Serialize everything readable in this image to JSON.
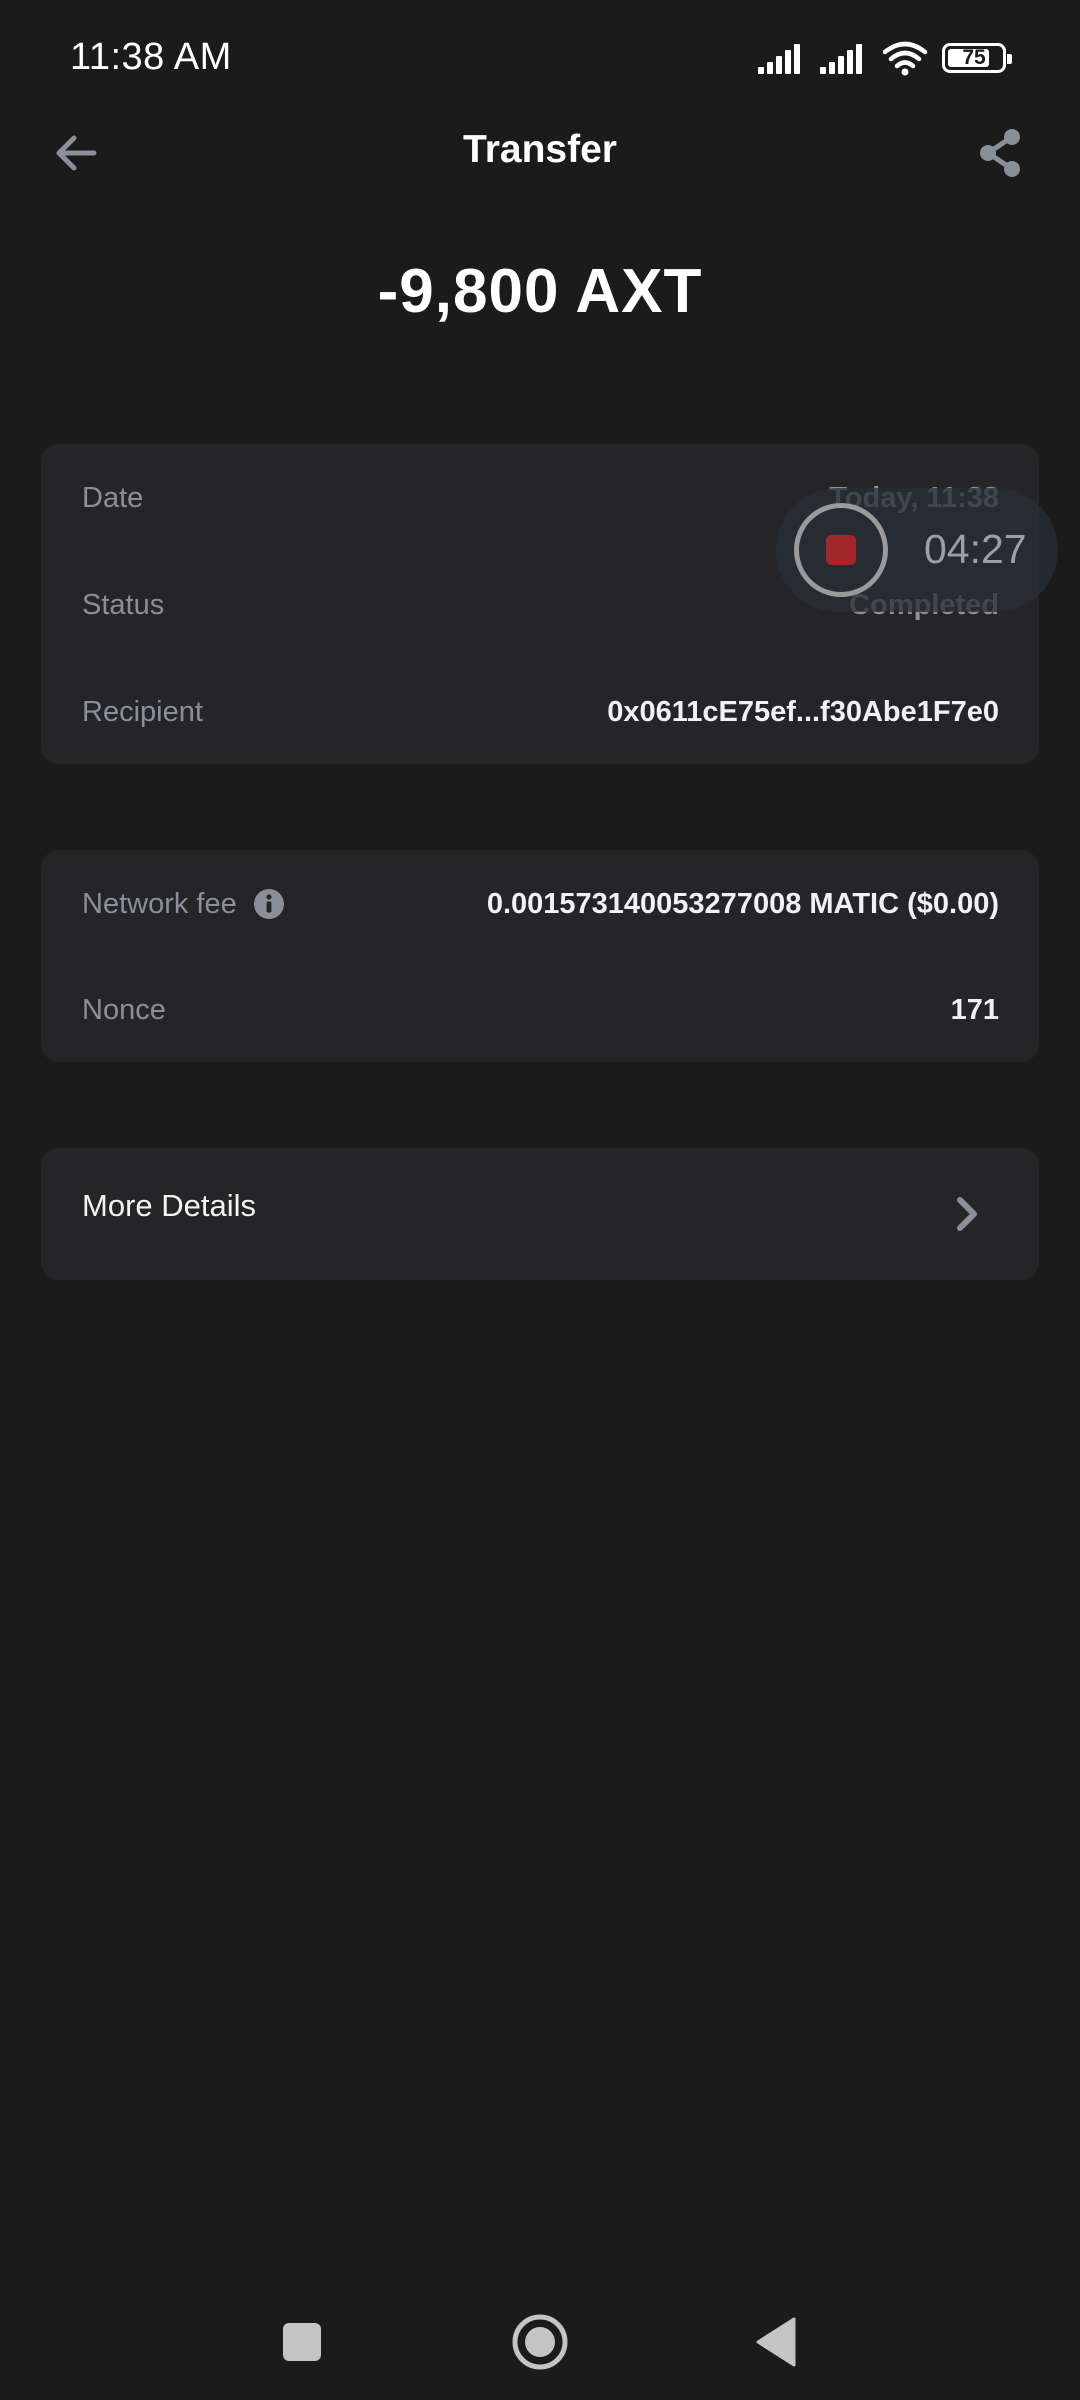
{
  "status_bar": {
    "time": "11:38 AM",
    "battery_level": "75",
    "icons": [
      "signal-icon",
      "signal-icon",
      "wifi-icon",
      "battery-icon"
    ]
  },
  "header": {
    "title": "Transfer",
    "back_icon": "back-arrow-icon",
    "share_icon": "share-icon"
  },
  "amount": "-9,800 AXT",
  "details": [
    {
      "label": "Date",
      "value": "Today, 11:38"
    },
    {
      "label": "Status",
      "value": "Completed"
    },
    {
      "label": "Recipient",
      "value": "0x0611cE75ef...f30Abe1F7e0"
    }
  ],
  "fees": [
    {
      "label": "Network fee",
      "value": "0.001573140053277008 MATIC ($0.00)"
    },
    {
      "label": "Nonce",
      "value": "171"
    }
  ],
  "more_details": {
    "label": "More Details",
    "icon": "chevron-right-icon"
  },
  "screen_recorder": {
    "time": "04:27",
    "icon": "stop-record-icon"
  },
  "nav_bar": {
    "icons": [
      "recents-icon",
      "home-icon",
      "back-icon"
    ]
  },
  "colors": {
    "background": "#1b1b1c",
    "card": "#252528",
    "label": "#8a8f99",
    "value": "#f0f1f3",
    "record": "#a3262a"
  }
}
